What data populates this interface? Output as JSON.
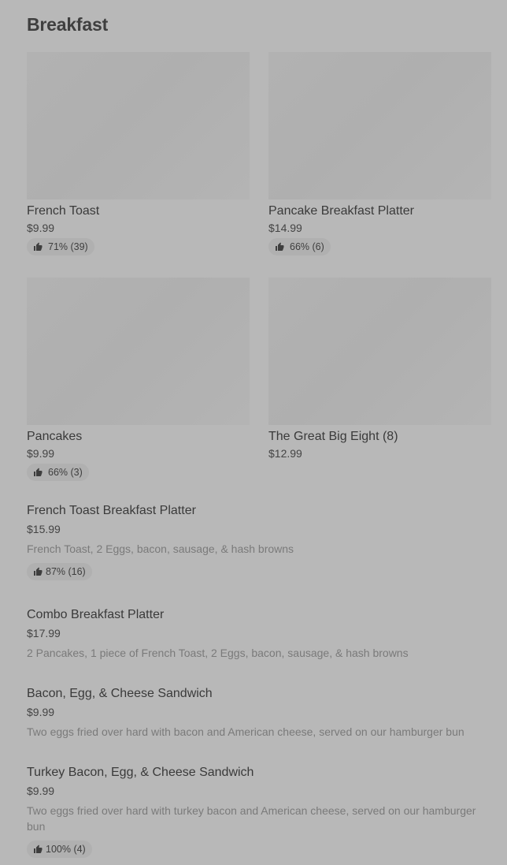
{
  "section": {
    "title": "Breakfast"
  },
  "grid_items": [
    {
      "name": "French Toast",
      "price": "$9.99",
      "rating": "71% (39)"
    },
    {
      "name": "Pancake Breakfast Platter",
      "price": "$14.99",
      "rating": "66% (6)"
    },
    {
      "name": "Pancakes",
      "price": "$9.99",
      "rating": "66% (3)"
    },
    {
      "name": "The Great Big Eight (8)",
      "price": "$12.99",
      "rating": ""
    }
  ],
  "list_items": [
    {
      "name": "French Toast Breakfast Platter",
      "price": "$15.99",
      "description": "French Toast, 2 Eggs, bacon, sausage, & hash browns",
      "rating": "87% (16)"
    },
    {
      "name": "Combo Breakfast Platter",
      "price": "$17.99",
      "description": "2 Pancakes, 1 piece of French Toast, 2 Eggs, bacon, sausage, & hash browns",
      "rating": ""
    },
    {
      "name": "Bacon, Egg, & Cheese Sandwich",
      "price": "$9.99",
      "description": "Two eggs fried over hard with bacon and American cheese, served on our hamburger bun",
      "rating": ""
    },
    {
      "name": "Turkey Bacon, Egg, & Cheese Sandwich",
      "price": "$9.99",
      "description": "Two eggs fried over hard with turkey bacon and American cheese, served on our hamburger bun",
      "rating": "100% (4)"
    }
  ],
  "icons": {
    "rating": "thumbs-up-icon",
    "placeholder": "image-placeholder"
  },
  "colors": {
    "background": "#b8b8b8",
    "image_placeholder": "#b1b1b1",
    "badge": "#b0b0b0",
    "text": "#3a3a3a",
    "description": "#7a7a7a"
  }
}
